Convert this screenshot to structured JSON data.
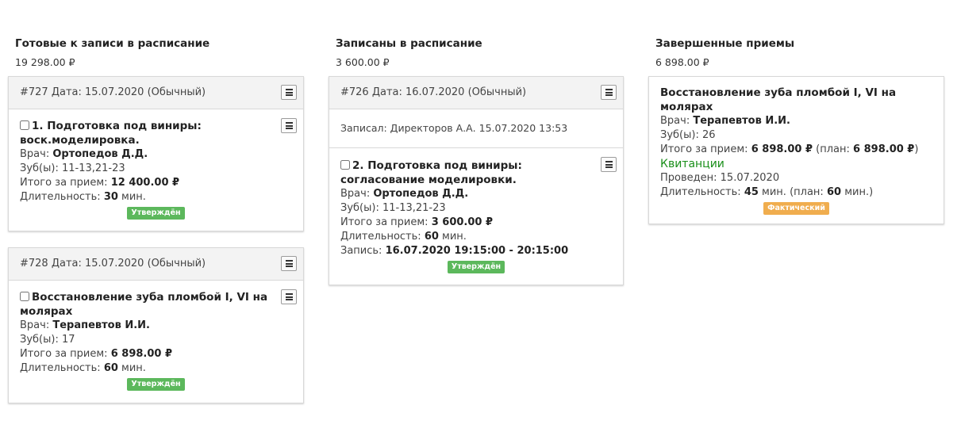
{
  "columns": [
    {
      "title": "Готовые к записи в расписание",
      "total": "19 298.00 ₽",
      "cards": [
        {
          "header": "#727 Дата: 15.07.2020 (Обычный)",
          "item": {
            "title": "1. Подготовка под виниры: воск.моделировка.",
            "doctor_label": "Врач:",
            "doctor": "Ортопедов Д.Д.",
            "teeth_label": "Зуб(ы):",
            "teeth": "11-13,21-23",
            "total_label": "Итого за прием:",
            "total": "12 400.00 ₽",
            "duration_label": "Длительность:",
            "duration": "30",
            "duration_unit": "мин.",
            "badge": "Утверждён"
          }
        },
        {
          "header": "#728 Дата: 15.07.2020 (Обычный)",
          "item": {
            "title": "Восстановление зуба пломбой  I, VI на молярах",
            "doctor_label": "Врач:",
            "doctor": "Терапевтов И.И.",
            "teeth_label": "Зуб(ы):",
            "teeth": "17",
            "total_label": "Итого за прием:",
            "total": "6 898.00 ₽",
            "duration_label": "Длительность:",
            "duration": "60",
            "duration_unit": "мин.",
            "badge": "Утверждён"
          }
        }
      ]
    },
    {
      "title": "Записаны в расписание",
      "total": "3 600.00 ₽",
      "cards": [
        {
          "header": "#726 Дата: 16.07.2020 (Обычный)",
          "recorded": "Записал: Директоров А.А. 15.07.2020 13:53",
          "item": {
            "title": "2. Подготовка под виниры: согласование моделировки.",
            "doctor_label": "Врач:",
            "doctor": "Ортопедов Д.Д.",
            "teeth_label": "Зуб(ы):",
            "teeth": "11-13,21-23",
            "total_label": "Итого за прием:",
            "total": "3 600.00 ₽",
            "duration_label": "Длительность:",
            "duration": "60",
            "duration_unit": "мин.",
            "appointment_label": "Запись:",
            "appointment": "16.07.2020 19:15:00 - 20:15:00",
            "badge": "Утверждён"
          }
        }
      ]
    },
    {
      "title": "Завершенные приемы",
      "total": "6 898.00 ₽",
      "cards": [
        {
          "item": {
            "title": "Восстановление зуба пломбой  I, VI на молярах",
            "doctor_label": "Врач:",
            "doctor": "Терапевтов И.И.",
            "teeth_label": "Зуб(ы):",
            "teeth": "26",
            "total_label": "Итого за прием:",
            "total": "6 898.00 ₽",
            "plan_open": "(план:",
            "plan_total": "6 898.00 ₽",
            "plan_close": ")",
            "receipts_link": "Квитанции",
            "done_label": "Проведен:",
            "done_date": "15.07.2020",
            "duration_label": "Длительность:",
            "duration": "45",
            "duration_unit": "мин.",
            "plan_duration_open": "(план:",
            "plan_duration": "60",
            "plan_duration_close": "мин.)",
            "badge": "Фактический"
          }
        }
      ]
    }
  ],
  "colors": {
    "approved_badge": "#5cb85c",
    "actual_badge": "#f0ad4e",
    "receipts_link": "#1a8f1a"
  }
}
